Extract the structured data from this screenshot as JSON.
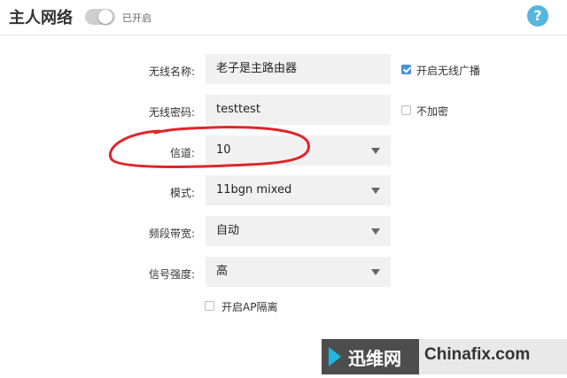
{
  "header": {
    "title": "主人网络",
    "toggle_status": "已开启",
    "help_symbol": "?"
  },
  "form": {
    "ssid": {
      "label": "无线名称:",
      "value": "老子是主路由器"
    },
    "broadcast": {
      "label": "开启无线广播",
      "checked": true
    },
    "password": {
      "label": "无线密码:",
      "value": "testtest"
    },
    "no_encrypt": {
      "label": "不加密",
      "checked": false
    },
    "channel": {
      "label": "信道:",
      "value": "10"
    },
    "mode": {
      "label": "模式:",
      "value": "11bgn mixed"
    },
    "bandwidth": {
      "label": "频段带宽:",
      "value": "自动"
    },
    "signal": {
      "label": "信号强度:",
      "value": "高"
    },
    "ap_isolation": {
      "label": "开启AP隔离",
      "checked": false
    }
  },
  "annotation": {
    "color": "#e0242b"
  },
  "watermark": {
    "cn": "迅维网",
    "en": "Chinafix.com",
    "accent": "#1fb6e6"
  },
  "colors": {
    "help": "#55b6df",
    "checkbox_on": "#4a90d9"
  }
}
